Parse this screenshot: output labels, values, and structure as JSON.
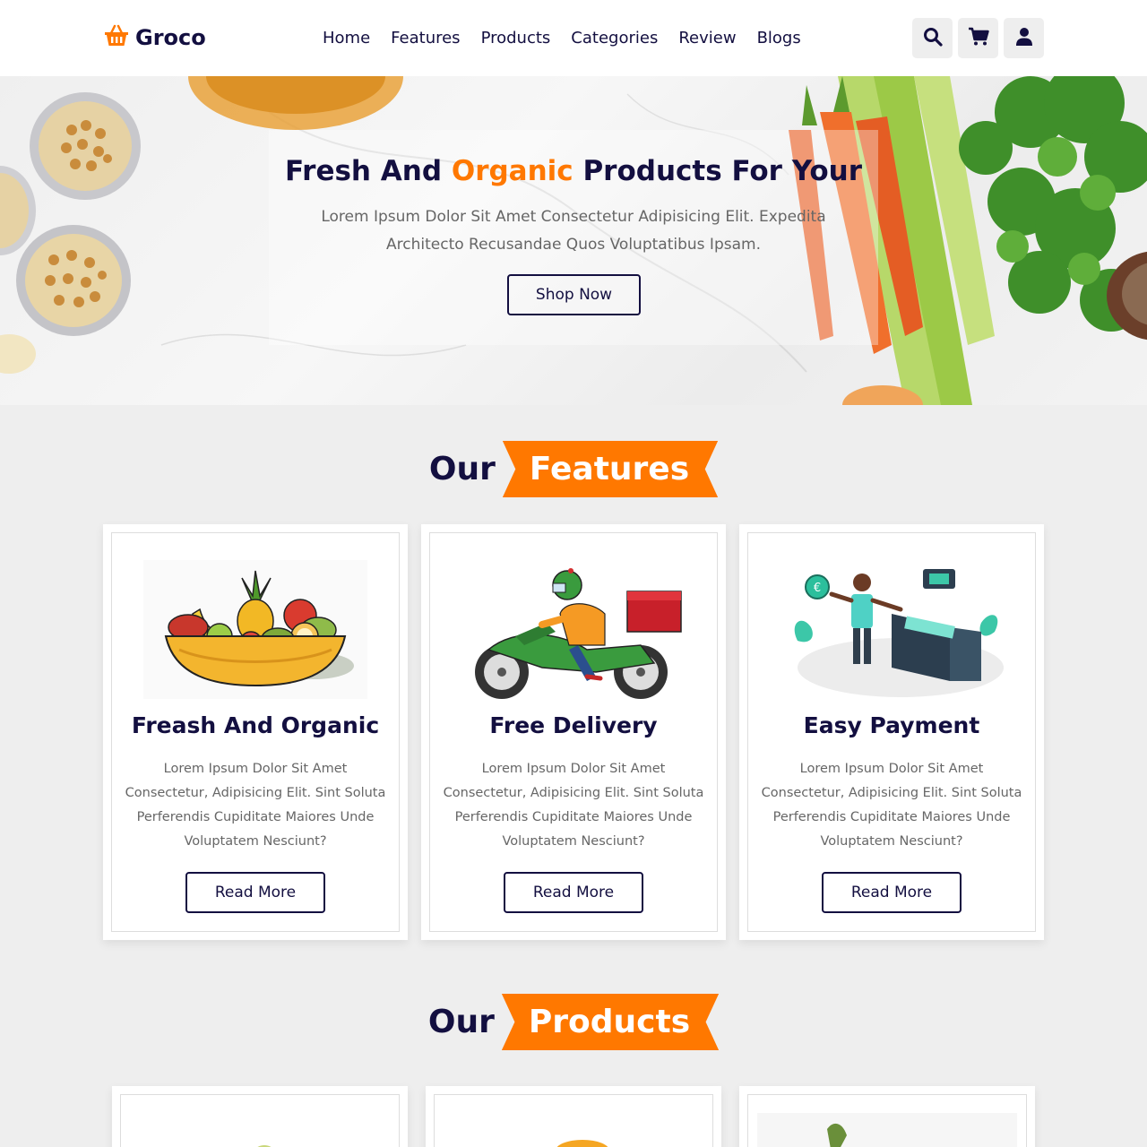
{
  "brand": {
    "name": "Groco",
    "accent_color": "#ff7800",
    "dark_color": "#130f40"
  },
  "nav": {
    "items": [
      "Home",
      "Features",
      "Products",
      "Categories",
      "Review",
      "Blogs"
    ]
  },
  "header_icons": [
    "search-icon",
    "cart-icon",
    "user-icon"
  ],
  "hero": {
    "title_before": "Fresh And ",
    "title_accent": "Organic",
    "title_after": " Products For Your",
    "subtitle": "Lorem Ipsum Dolor Sit Amet Consectetur Adipisicing Elit. Expedita Architecto Recusandae Quos Voluptatibus Ipsam.",
    "button": "Shop Now"
  },
  "features_heading": {
    "plain": "Our",
    "ribbon": "Features"
  },
  "features": [
    {
      "title": "Freash And Organic",
      "text": "Lorem Ipsum Dolor Sit Amet Consectetur, Adipisicing Elit. Sint Soluta Perferendis Cupiditate Maiores Unde Voluptatem Nesciunt?",
      "button": "Read More",
      "image": "fruit-bowl-image"
    },
    {
      "title": "Free Delivery",
      "text": "Lorem Ipsum Dolor Sit Amet Consectetur, Adipisicing Elit. Sint Soluta Perferendis Cupiditate Maiores Unde Voluptatem Nesciunt?",
      "button": "Read More",
      "image": "delivery-scooter-image"
    },
    {
      "title": "Easy Payment",
      "text": "Lorem Ipsum Dolor Sit Amet Consectetur, Adipisicing Elit. Sint Soluta Perferendis Cupiditate Maiores Unde Voluptatem Nesciunt?",
      "button": "Read More",
      "image": "payment-wallet-image"
    }
  ],
  "products_heading": {
    "plain": "Our",
    "ribbon": "Products"
  }
}
